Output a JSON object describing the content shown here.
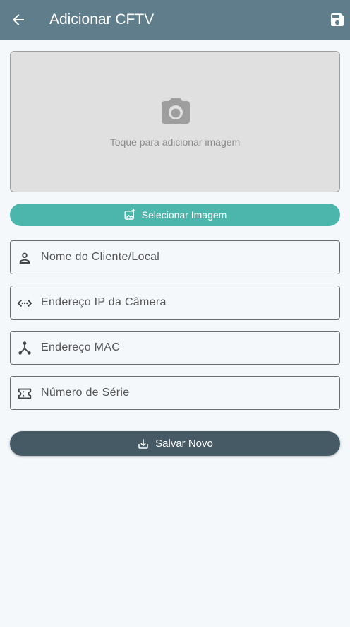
{
  "app_bar": {
    "title": "Adicionar CFTV",
    "back_icon": "arrow-back-icon",
    "save_icon": "floppy-save-icon",
    "color": "#607d8b"
  },
  "image_picker": {
    "hint": "Toque para adicionar imagem",
    "icon": "camera-icon"
  },
  "select_image_button": {
    "label": "Selecionar Imagem",
    "icon": "add-photo-icon",
    "color": "#4db6ac"
  },
  "fields": {
    "client": {
      "placeholder": "Nome do Cliente/Local",
      "value": "",
      "icon": "person-icon"
    },
    "ip": {
      "placeholder": "Endereço IP da Câmera",
      "value": "",
      "icon": "code-network-icon"
    },
    "mac": {
      "placeholder": "Endereço MAC",
      "value": "",
      "icon": "hub-icon"
    },
    "serial": {
      "placeholder": "Número de Série",
      "value": "",
      "icon": "ticket-icon"
    }
  },
  "save_new_button": {
    "label": "Salvar Novo",
    "icon": "download-icon",
    "color": "#455a64"
  }
}
